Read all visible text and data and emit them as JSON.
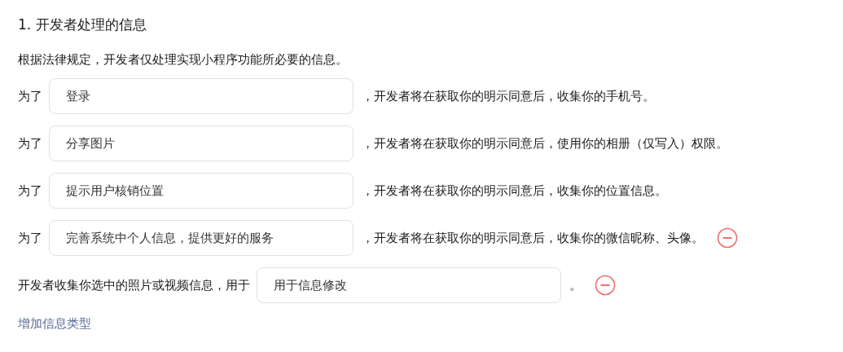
{
  "section_title": "1. 开发者处理的信息",
  "intro": "根据法律规定，开发者仅处理实现小程序功能所必要的信息。",
  "rows": [
    {
      "prefix": "为了",
      "value": "登录",
      "suffix": "，开发者将在获取你的明示同意后，收集你的手机号。",
      "removable": false
    },
    {
      "prefix": "为了",
      "value": "分享图片",
      "suffix": "，开发者将在获取你的明示同意后，使用你的相册（仅写入）权限。",
      "removable": false
    },
    {
      "prefix": "为了",
      "value": "提示用户核销位置",
      "suffix": "，开发者将在获取你的明示同意后，收集你的位置信息。",
      "removable": false
    },
    {
      "prefix": "为了",
      "value": "完善系统中个人信息，提供更好的服务",
      "suffix": "，开发者将在获取你的明示同意后，收集你的微信昵称、头像。",
      "removable": true
    },
    {
      "prefix": "开发者收集你选中的照片或视频信息，用于",
      "value": "用于信息修改",
      "suffix": "。",
      "removable": true
    }
  ],
  "add_link": "增加信息类型"
}
